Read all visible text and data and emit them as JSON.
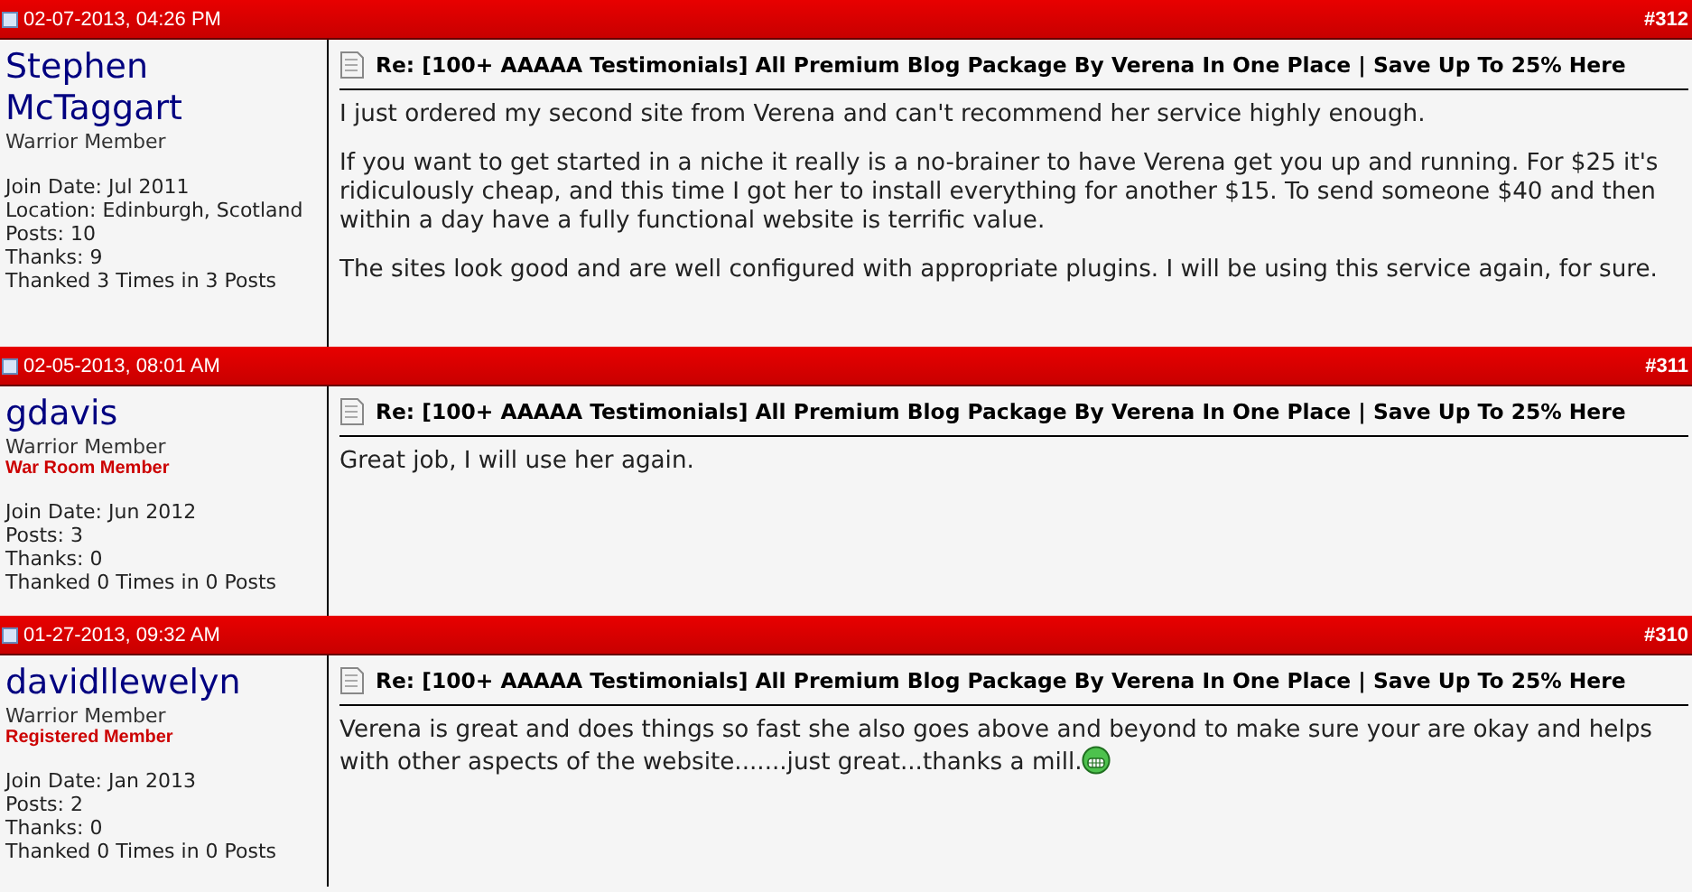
{
  "posts": [
    {
      "date": "02-07-2013, 04:26 PM",
      "number": "#312",
      "user": {
        "name": "Stephen McTaggart",
        "rank": "Warrior Member",
        "details": [
          "Join Date: Jul 2011",
          "Location: Edinburgh, Scotland",
          "Posts: 10",
          "Thanks: 9",
          "Thanked 3 Times in 3 Posts"
        ]
      },
      "title": "Re: [100+ AAAAA Testimonials] All Premium Blog Package By Verena In One Place | Save Up To 25% Here",
      "paragraphs": [
        "I just ordered my second site from Verena and can't recommend her service highly enough.",
        "If you want to get started in a niche it really is a no-brainer to have Verena get you up and running. For $25 it's ridiculously cheap, and this time I got her to install everything for another $15. To send someone $40 and then within a day have a fully functional website is terrific value.",
        "The sites look good and are well configured with appropriate plugins. I will be using this service again, for sure."
      ],
      "smiley": false
    },
    {
      "date": "02-05-2013, 08:01 AM",
      "number": "#311",
      "user": {
        "name": "gdavis",
        "rank": "Warrior Member",
        "badge": "War Room Member",
        "details": [
          "Join Date: Jun 2012",
          "Posts: 3",
          "Thanks: 0",
          "Thanked 0 Times in 0 Posts"
        ]
      },
      "title": "Re: [100+ AAAAA Testimonials] All Premium Blog Package By Verena In One Place | Save Up To 25% Here",
      "paragraphs": [
        "Great job, I will use her again."
      ],
      "smiley": false
    },
    {
      "date": "01-27-2013, 09:32 AM",
      "number": "#310",
      "user": {
        "name": "davidllewelyn",
        "rank": "Warrior Member",
        "badge": "Registered Member",
        "details": [
          "Join Date: Jan 2013",
          "Posts: 2",
          "Thanks: 0",
          "Thanked 0 Times in 0 Posts"
        ]
      },
      "title": "Re: [100+ AAAAA Testimonials] All Premium Blog Package By Verena In One Place | Save Up To 25% Here",
      "paragraphs": [
        "Verena is great and does things so fast she also goes above and beyond to make sure your are okay and helps with other aspects of the website.......just great...thanks a mill."
      ],
      "smiley": true
    }
  ]
}
